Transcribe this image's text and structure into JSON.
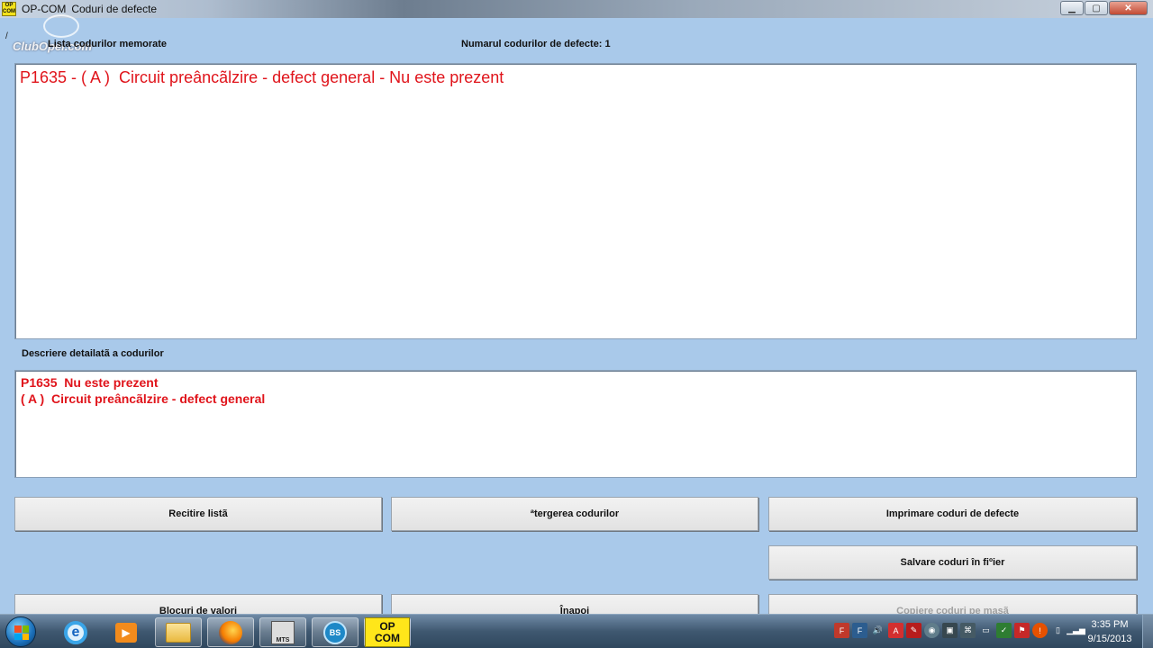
{
  "window": {
    "app_name": "OP-COM",
    "title": "Coduri de defecte",
    "icon_text": "OP\nCOM"
  },
  "watermark": {
    "text": "ClubOpel.com"
  },
  "slash": "/",
  "labels": {
    "codes_list": "Lista codurilor memorate",
    "codes_count": "Numarul codurilor de defecte: 1",
    "detailed_desc": "Descriere detailatã a codurilor"
  },
  "codes_list": [
    "P1635 - ( A )  Circuit preâncãlzire - defect general - Nu este prezent"
  ],
  "description": [
    "P1635  Nu este prezent",
    "( A )  Circuit preâncãlzire - defect general"
  ],
  "buttons": {
    "reread": "Recitire listã",
    "erase": "ªtergerea codurilor",
    "print": "Imprimare coduri de defecte",
    "save": "Salvare coduri în fiºier",
    "blocks": "Blocuri de valori",
    "back": "Înapoi",
    "copy": "Copiere coduri pe masã"
  },
  "taskbar": {
    "items": [
      "internet-explorer",
      "media-player",
      "file-explorer",
      "firefox",
      "mts",
      "bs",
      "op-com"
    ],
    "active": "op-com",
    "opcom_label_top": "OP",
    "opcom_label_bottom": "COM",
    "mts_label": "MTS",
    "bs_label": "BS",
    "clock_time": "3:35 PM",
    "clock_date": "9/15/2013"
  },
  "colors": {
    "background": "#a9c9ea",
    "code_text": "#e0141b",
    "panel": "#ffffff"
  }
}
